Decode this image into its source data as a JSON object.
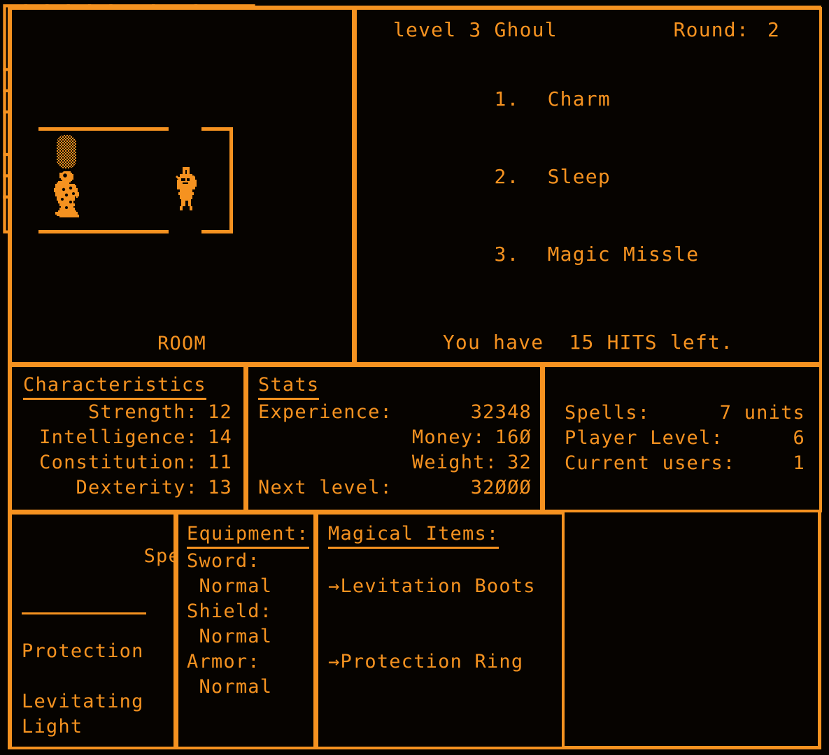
{
  "theme": {
    "background": "#060300",
    "foreground": "#f59220"
  },
  "room_view": {
    "label": "ROOM",
    "sprites": [
      {
        "name": "ghoul-sprite",
        "description": "ghoul enemy figure"
      },
      {
        "name": "knight-sprite",
        "description": "armored player knight figure"
      },
      {
        "name": "object-sprite",
        "description": "dithered rounded block object"
      }
    ]
  },
  "combat": {
    "encounter": "level 3 Ghoul",
    "round_label": "Round:",
    "round_value": "2",
    "spell_options": [
      {
        "number": "1.",
        "name": "Charm"
      },
      {
        "number": "2.",
        "name": "Sleep"
      },
      {
        "number": "3.",
        "name": "Magic Missle"
      }
    ],
    "hits_line": "You have  15 HITS left."
  },
  "characteristics": {
    "title": "Characteristics",
    "rows": [
      {
        "label": "Strength:",
        "value": "12"
      },
      {
        "label": "Intelligence:",
        "value": "14"
      },
      {
        "label": "Constitution:",
        "value": "11"
      },
      {
        "label": "Dexterity:",
        "value": "13"
      }
    ]
  },
  "stats": {
    "title": "Stats",
    "rows": [
      {
        "label": "Experience:",
        "value": "32348"
      },
      {
        "label": "Money:",
        "value": "16Ø"
      },
      {
        "label": "Weight:",
        "value": "32"
      },
      {
        "label": "Next level:",
        "value": "32ØØØ"
      }
    ]
  },
  "party": {
    "rows": [
      {
        "label": "Spells:",
        "value": "7 units"
      },
      {
        "label": "Player Level:",
        "value": "6"
      },
      {
        "label": "Current users:",
        "value": "1"
      }
    ]
  },
  "spells_on": {
    "title": "Spells On:",
    "items": [
      "Protection",
      "Levitating",
      "Light"
    ]
  },
  "equipment": {
    "title": "Equipment:",
    "rows": [
      {
        "slot": "Sword:",
        "quality": " Normal"
      },
      {
        "slot": "Shield:",
        "quality": " Normal"
      },
      {
        "slot": "Armor:",
        "quality": " Normal"
      }
    ]
  },
  "magical_items": {
    "title": "Magical Items:",
    "items": [
      {
        "marker": "→",
        "name": "Levitation Boots"
      },
      {
        "marker": "→",
        "name": "Protection Ring"
      }
    ]
  },
  "map": {
    "name": "dungeon-maze-map",
    "player_marker": "o"
  }
}
